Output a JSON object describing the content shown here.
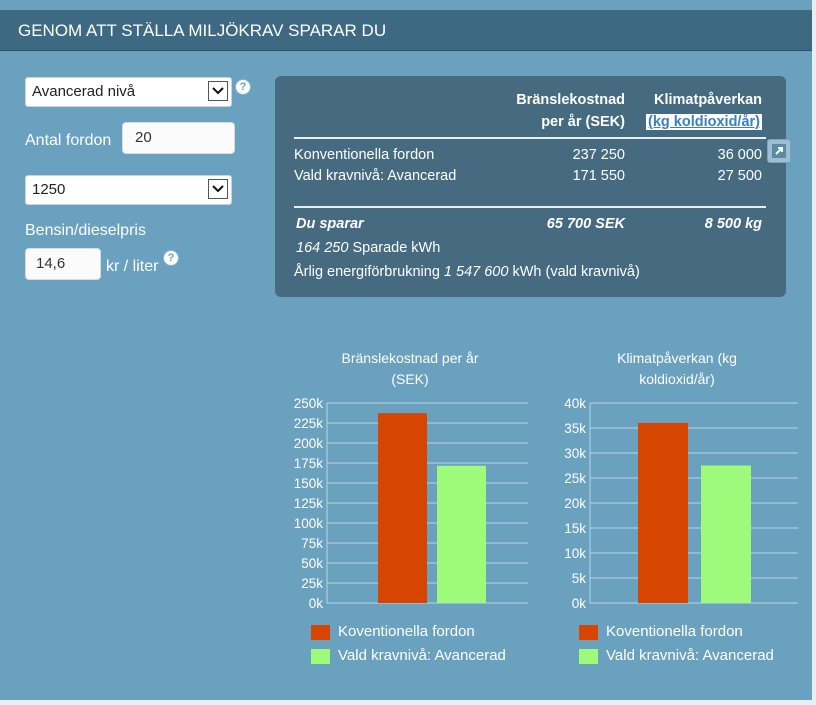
{
  "header": {
    "title": "GENOM ATT STÄLLA MILJÖKRAV SPARAR DU"
  },
  "form": {
    "level_select": "Avancerad nivå",
    "fleet_label": "Antal fordon",
    "fleet_value": "20",
    "distance_select": "1250",
    "fuel_price_label": "Bensin/dieselpris",
    "fuel_price_value": "14,6",
    "fuel_price_unit": "kr / liter",
    "help_glyph": "?"
  },
  "summary": {
    "col1_header_line1": "Bränslekostnad",
    "col1_header_line2": "per år (SEK)",
    "col2_header_line1": "Klimatpåverkan",
    "col2_header_link": "(kg koldioxid/år)",
    "rows": [
      {
        "label": "Konventionella fordon",
        "cost": "237 250",
        "climate": "36 000"
      },
      {
        "label": "Vald kravnivå: Avancerad",
        "cost": "171 550",
        "climate": "27 500"
      }
    ],
    "savings_label": "Du sparar",
    "savings_cost": "65 700 SEK",
    "savings_climate": "8 500 kg",
    "kwh_value": "164 250",
    "kwh_text": "Sparade kWh",
    "annual_prefix": "Årlig energiförbrukning",
    "annual_value": "1 547 600",
    "annual_suffix": "kWh (vald kravnivå)"
  },
  "colors": {
    "conventional": "#d64600",
    "selected": "#9dfa7b"
  },
  "chart_data": [
    {
      "type": "bar",
      "title_line1": "Bränslekostnad per år",
      "title_line2": "(SEK)",
      "ylim": [
        0,
        250000
      ],
      "ticks": [
        "0k",
        "25k",
        "50k",
        "75k",
        "100k",
        "125k",
        "150k",
        "175k",
        "200k",
        "225k",
        "250k"
      ],
      "series": [
        {
          "name": "Koventionella fordon",
          "values": [
            237250
          ]
        },
        {
          "name": "Vald kravnivå: Avancerad",
          "values": [
            171550
          ]
        }
      ],
      "grid": true,
      "legend": "bottom"
    },
    {
      "type": "bar",
      "title_line1": "Klimatpåverkan (kg",
      "title_line2": "koldioxid/år)",
      "ylim": [
        0,
        40000
      ],
      "ticks": [
        "0k",
        "5k",
        "10k",
        "15k",
        "20k",
        "25k",
        "30k",
        "35k",
        "40k"
      ],
      "series": [
        {
          "name": "Koventionella fordon",
          "values": [
            36000
          ]
        },
        {
          "name": "Vald kravnivå: Avancerad",
          "values": [
            27500
          ]
        }
      ],
      "grid": true,
      "legend": "bottom"
    }
  ]
}
